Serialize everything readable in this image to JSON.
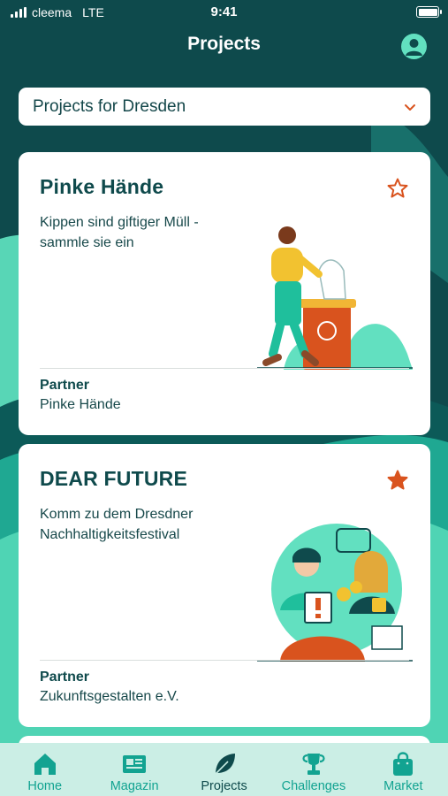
{
  "status_bar": {
    "carrier": "cleema",
    "network": "LTE",
    "time": "9:41"
  },
  "header": {
    "title": "Projects",
    "profile_icon": "user-icon"
  },
  "city_select": {
    "label": "Projects for Dresden",
    "icon": "chevron-down-icon"
  },
  "projects": [
    {
      "title": "Pinke Hände",
      "description": "Kippen sind giftiger Müll - sammle sie ein",
      "partner_label": "Partner",
      "partner_name": "Pinke Hände",
      "favorited": false,
      "icon": "star-outline-icon"
    },
    {
      "title": "DEAR FUTURE",
      "description": "Komm zu dem Dresdner Nachhaltigkeitsfestival",
      "partner_label": "Partner",
      "partner_name": "Zukunftsgestalten e.V.",
      "favorited": true,
      "icon": "star-filled-icon"
    }
  ],
  "tabs": [
    {
      "label": "Home",
      "icon": "home-icon",
      "active": false
    },
    {
      "label": "Magazin",
      "icon": "newspaper-icon",
      "active": false
    },
    {
      "label": "Projects",
      "icon": "leaf-icon",
      "active": true
    },
    {
      "label": "Challenges",
      "icon": "trophy-icon",
      "active": false
    },
    {
      "label": "Market",
      "icon": "shopping-bag-icon",
      "active": false
    }
  ],
  "colors": {
    "background": "#0e4a4c",
    "mint": "#62e0c0",
    "accent_orange": "#d9531e",
    "tab_bar": "#cbeee5",
    "tab_active": "#0f4a4c",
    "tab_inactive": "#12a391"
  }
}
